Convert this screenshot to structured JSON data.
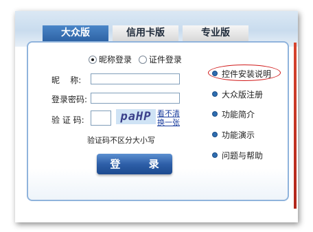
{
  "tabs": [
    {
      "label": "大众版",
      "active": true
    },
    {
      "label": "信用卡版",
      "active": false
    },
    {
      "label": "专业版",
      "active": false
    }
  ],
  "login_type": {
    "options": [
      "昵称登录",
      "证件登录"
    ],
    "selected": "昵称登录"
  },
  "form": {
    "nickname_label": "昵    称:",
    "password_label": "登录密码:",
    "captcha_label": "验 证 码:",
    "captcha_image_text": "paHP",
    "change_captcha": "看不清换一张",
    "captcha_hint": "验证码不区分大小写",
    "login_button": "登 录"
  },
  "links": [
    {
      "label": "控件安装说明",
      "highlighted": true
    },
    {
      "label": "大众版注册",
      "highlighted": false
    },
    {
      "label": "功能简介",
      "highlighted": false
    },
    {
      "label": "功能演示",
      "highlighted": false
    },
    {
      "label": "问题与帮助",
      "highlighted": false
    }
  ],
  "colors": {
    "accent_blue": "#2e63a5",
    "highlight_red": "#d01818"
  }
}
